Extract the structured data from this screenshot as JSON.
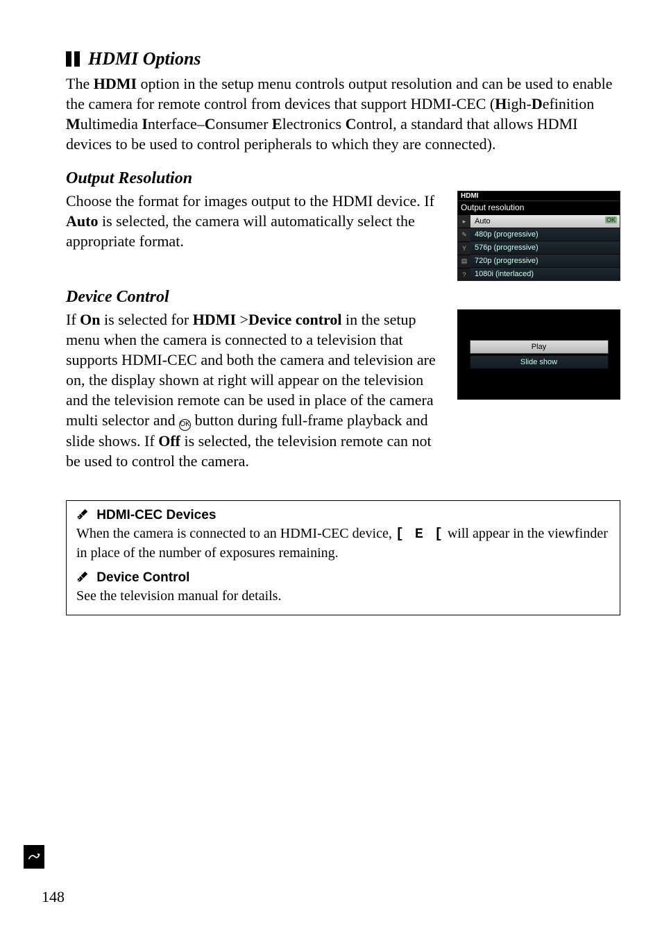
{
  "section1": {
    "title": "HDMI Options",
    "body": "The <b>HDMI</b> option in the setup menu controls output resolution and can be used to enable the camera for remote control from devices that support HDMI-CEC (<b>H</b>igh-<b>D</b>efinition <b>M</b>ultimedia <b>I</b>nterface–<b>C</b>onsumer <b>E</b>lectronics <b>C</b>ontrol, a standard that allows HDMI devices to be used to control peripherals to which they are connected)."
  },
  "section2": {
    "title": "Output Resolution",
    "body": "Choose the format for images output to the HDMI device. If <b>Auto</b> is selected, the camera will automatically select the appropriate format."
  },
  "section3": {
    "title": "Device Control",
    "body_pre": "If <b>On</b> is selected for <b>HDMI</b> >",
    "body_mid": "<b>Device control</b> in the setup menu when the camera is connected to a television that supports HDMI-CEC and both the camera and television are on, the display shown at right will appear on the television and the television remote can be used in place of the camera multi selector and ",
    "body_post": " button during full-frame playback and slide shows. If <b>Off</b> is selected, the television remote can not be used to control the camera."
  },
  "camera_menu": {
    "top": "HDMI",
    "label": "Output resolution",
    "items": [
      "Auto",
      "480p (progressive)",
      "576p (progressive)",
      "720p (progressive)",
      "1080i (interlaced)"
    ],
    "ok": "OK"
  },
  "tv_menu": {
    "items": [
      "Play",
      "Slide show"
    ]
  },
  "notes": {
    "h1": "HDMI-CEC Devices",
    "b1_pre": "When the camera is connected to an HDMI-CEC device, ",
    "b1_post": " will appear in the viewfinder in place of the number of exposures remaining.",
    "cec_glyph_text": "[ E [",
    "h2": "Device Control",
    "b2": "See the television manual for details."
  },
  "page_number": "148"
}
